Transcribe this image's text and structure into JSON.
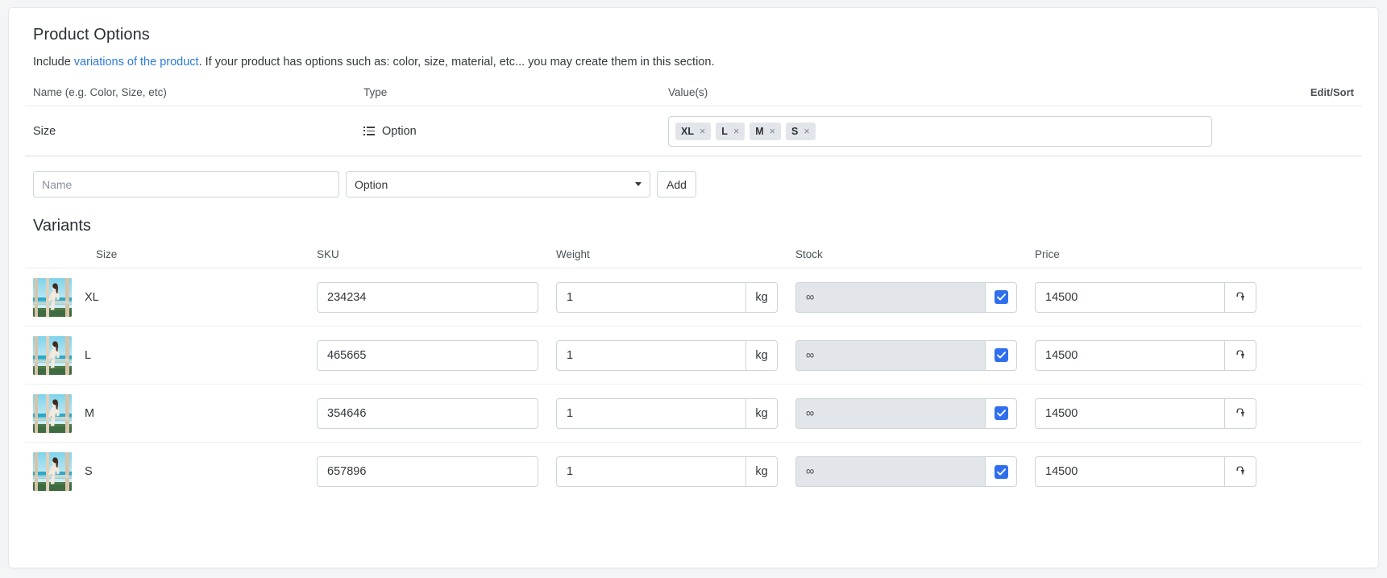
{
  "section": {
    "title": "Product Options",
    "description_prefix": "Include ",
    "description_link": "variations of the product",
    "description_suffix": ". If your product has options such as: color, size, material, etc... you may create them in this section.",
    "link_color": "#2b7bd4"
  },
  "options_table": {
    "headers": {
      "name": "Name (e.g. Color, Size, etc)",
      "type": "Type",
      "values": "Value(s)",
      "edit_sort": "Edit/Sort"
    },
    "rows": [
      {
        "name": "Size",
        "type": "Option",
        "type_icon": "list-icon",
        "values": [
          "XL",
          "L",
          "M",
          "S"
        ],
        "remove_glyph": "×"
      }
    ]
  },
  "add_option_form": {
    "name_placeholder": "Name",
    "name_value": "",
    "type_selected": "Option",
    "type_options": [
      "Option"
    ],
    "add_label": "Add"
  },
  "variants": {
    "title": "Variants",
    "headers": {
      "size": "Size",
      "sku": "SKU",
      "weight": "Weight",
      "stock": "Stock",
      "price": "Price"
    },
    "weight_unit": "kg",
    "currency_symbol": "֏",
    "stock_infinite_glyph": "∞",
    "rows": [
      {
        "size": "XL",
        "sku": "234234",
        "weight": "1",
        "stock": "∞",
        "stock_unlimited": true,
        "price": "14500"
      },
      {
        "size": "L",
        "sku": "465665",
        "weight": "1",
        "stock": "∞",
        "stock_unlimited": true,
        "price": "14500"
      },
      {
        "size": "M",
        "sku": "354646",
        "weight": "1",
        "stock": "∞",
        "stock_unlimited": true,
        "price": "14500"
      },
      {
        "size": "S",
        "sku": "657896",
        "weight": "1",
        "stock": "∞",
        "stock_unlimited": true,
        "price": "14500"
      }
    ]
  },
  "colors": {
    "page_background": "#f4f5f7",
    "card_background": "#ffffff",
    "border": "#ced4da",
    "tag_background": "#e2e6eb",
    "checkbox_accent": "#2f6fed",
    "disabled_input": "#e2e5e9"
  }
}
